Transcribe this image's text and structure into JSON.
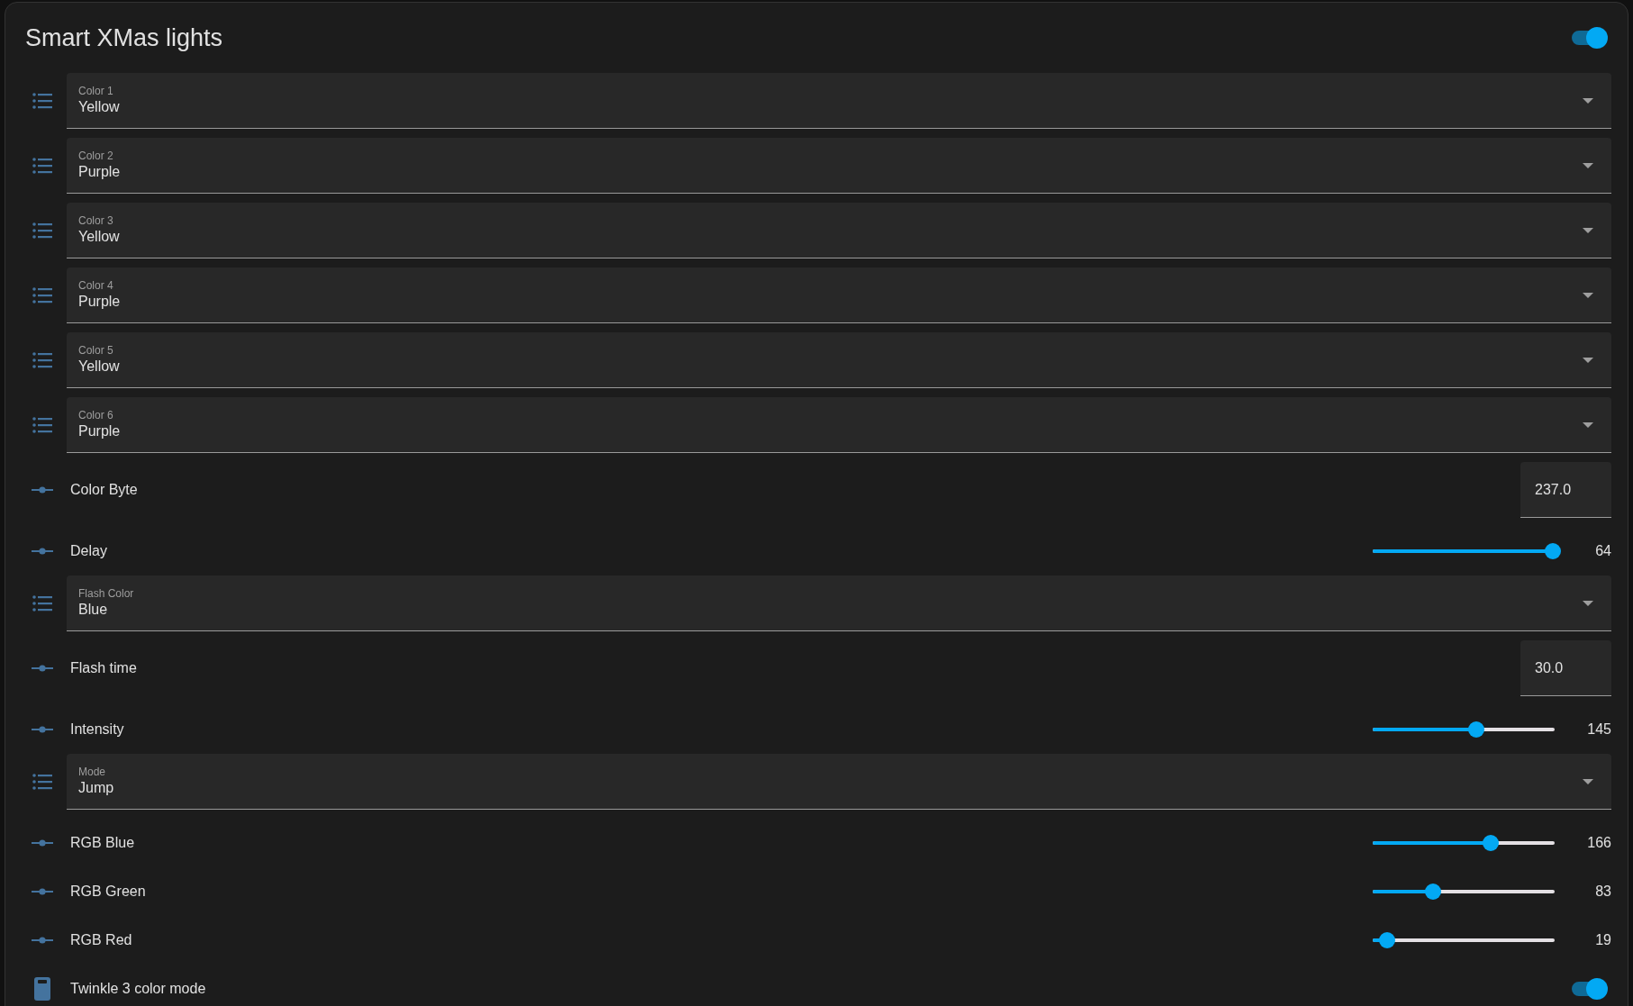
{
  "card": {
    "title": "Smart XMas lights",
    "header_toggle": {
      "on": true
    }
  },
  "entities": [
    {
      "kind": "select",
      "label": "Color 1",
      "value": "Yellow"
    },
    {
      "kind": "select",
      "label": "Color 2",
      "value": "Purple"
    },
    {
      "kind": "select",
      "label": "Color 3",
      "value": "Yellow"
    },
    {
      "kind": "select",
      "label": "Color 4",
      "value": "Purple"
    },
    {
      "kind": "select",
      "label": "Color 5",
      "value": "Yellow"
    },
    {
      "kind": "select",
      "label": "Color 6",
      "value": "Purple"
    },
    {
      "kind": "number",
      "label": "Color Byte",
      "value": "237.0"
    },
    {
      "kind": "slider",
      "label": "Delay",
      "level": 0.99,
      "value": "64"
    },
    {
      "kind": "select",
      "label": "Flash Color",
      "value": "Blue"
    },
    {
      "kind": "number",
      "label": "Flash time",
      "value": "30.0"
    },
    {
      "kind": "slider",
      "label": "Intensity",
      "level": 0.57,
      "value": "145"
    },
    {
      "kind": "select",
      "label": "Mode",
      "value": "Jump"
    },
    {
      "kind": "slider",
      "label": "RGB Blue",
      "level": 0.65,
      "value": "166"
    },
    {
      "kind": "slider",
      "label": "RGB Green",
      "level": 0.33,
      "value": "83"
    },
    {
      "kind": "slider",
      "label": "RGB Red",
      "level": 0.08,
      "value": "19"
    },
    {
      "kind": "switch",
      "label": "Twinkle 3 color mode",
      "on": true
    }
  ]
}
